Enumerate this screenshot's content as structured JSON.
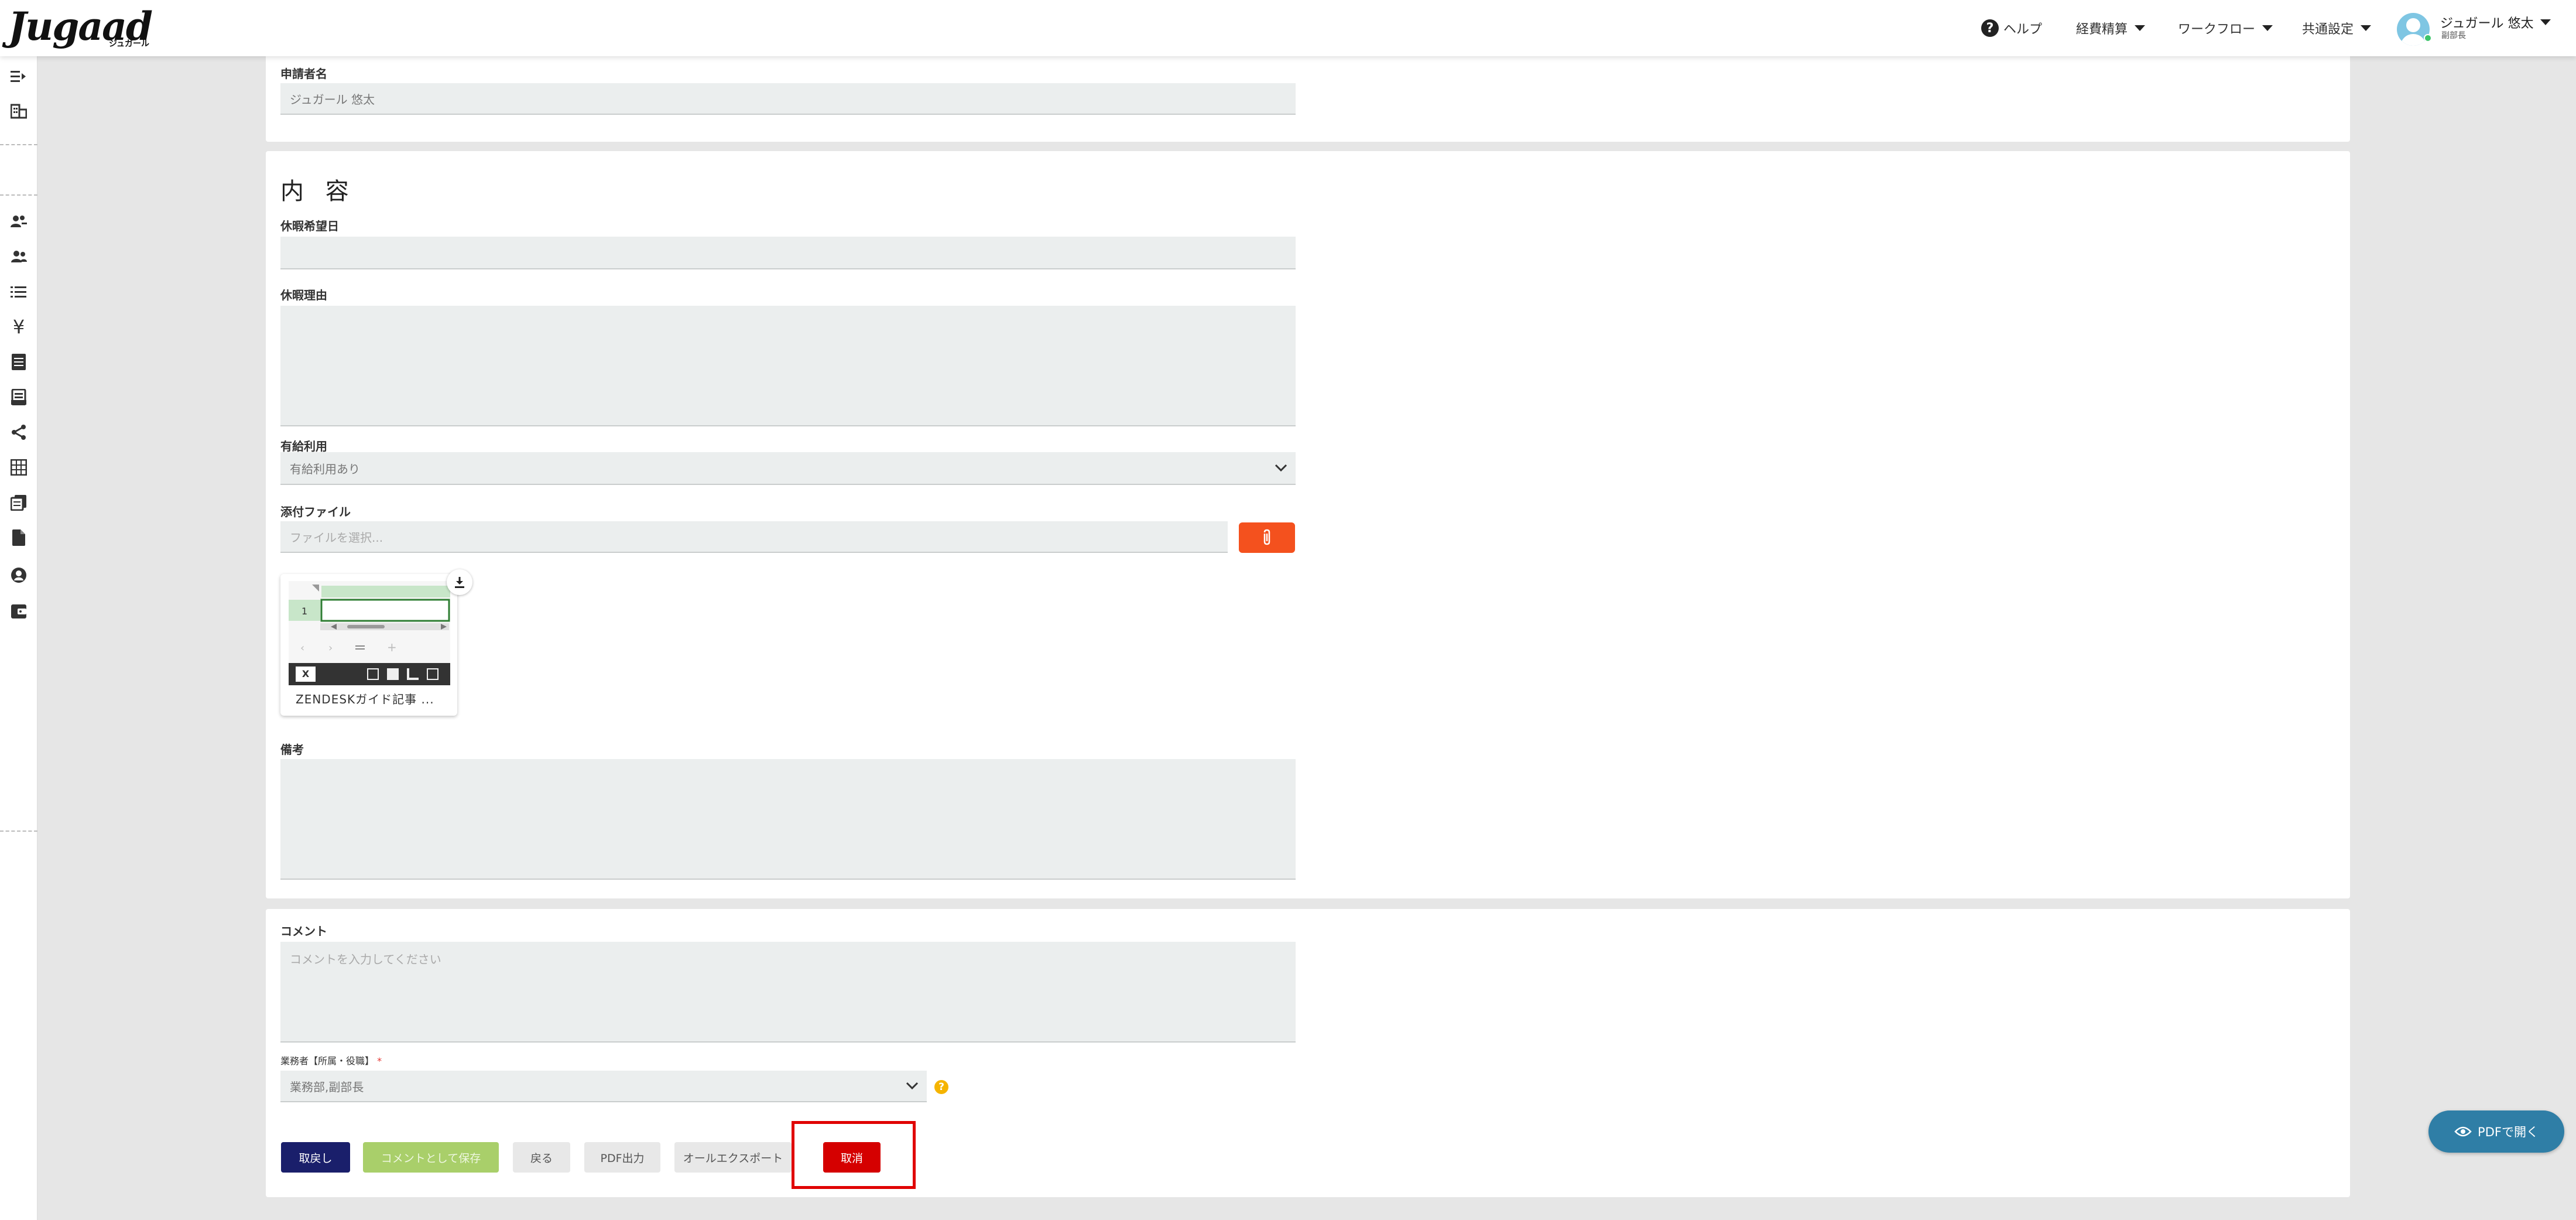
{
  "header": {
    "logo_text": "Jugaad",
    "logo_sub": "ジュガール",
    "help_label": "ヘルプ",
    "nav": [
      {
        "label": "経費精算"
      },
      {
        "label": "ワークフロー"
      },
      {
        "label": "共通設定"
      }
    ],
    "user_name": "ジュガール 悠太",
    "user_role": "副部長"
  },
  "sidebar": {
    "icons": [
      "menu-expand-icon",
      "building-icon",
      "users-icon",
      "user-group-icon",
      "list-icon",
      "yen-icon",
      "document-list-icon",
      "receipt-icon",
      "share-icon",
      "table-icon",
      "copy-icon",
      "file-icon",
      "support-icon",
      "wallet-icon"
    ]
  },
  "applicant": {
    "label": "申請者名",
    "value": "ジュガール 悠太"
  },
  "content": {
    "title": "内 容",
    "desired_date_label": "休暇希望日",
    "desired_date_value": "",
    "reason_label": "休暇理由",
    "reason_value": "",
    "paid_leave_label": "有給利用",
    "paid_leave_value": "有給利用あり",
    "attachment_label": "添付ファイル",
    "attachment_placeholder": "ファイルを選択...",
    "attached_file_name": "ZENDESKガイド記事 ...",
    "thumb_row_number": "1",
    "remarks_label": "備考",
    "remarks_value": ""
  },
  "comment": {
    "label": "コメント",
    "placeholder": "コメントを入力してください",
    "approver_label": "業務者【所属・役職】",
    "required_mark": "*",
    "approver_value": "業務部,副部長"
  },
  "buttons": {
    "withdraw": "取戻し",
    "save_comment": "コメントとして保存",
    "back": "戻る",
    "pdf_output": "PDF出力",
    "all_export": "オールエクスポート",
    "cancel": "取消"
  },
  "floating": {
    "pdf_open": "PDFで開く"
  },
  "colors": {
    "navy": "#1a1f6b",
    "green_disabled": "#a9cf6a",
    "cancel_red": "#d50000",
    "attach_orange": "#f4511e",
    "highlight_red": "#e00000",
    "pdf_open_blue": "#2f7ea6"
  }
}
